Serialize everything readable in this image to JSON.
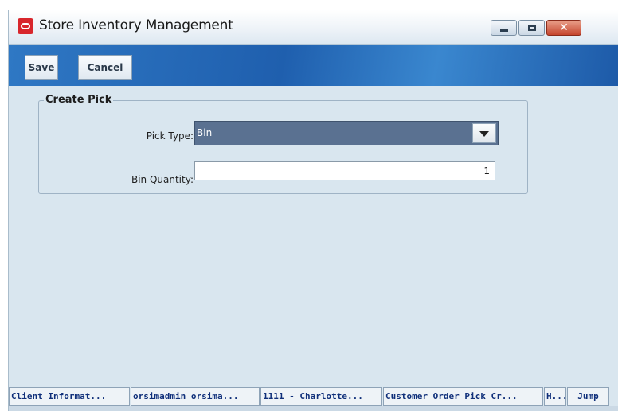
{
  "window": {
    "title": "Store Inventory Management",
    "logo_icon": "oracle-logo-icon",
    "controls": {
      "minimize_icon": "minimize-icon",
      "maximize_icon": "maximize-icon",
      "close_glyph": "✕"
    }
  },
  "toolbar": {
    "save_label": "Save",
    "cancel_label": "Cancel"
  },
  "form": {
    "group_title": "Create Pick",
    "pick_type_label": "Pick Type:",
    "pick_type_value": "Bin",
    "bin_quantity_label": "Bin Quantity:",
    "bin_quantity_value": "1"
  },
  "statusbar": {
    "cells": [
      "Client Informat...",
      "orsimadmin orsima...",
      "1111 - Charlotte...",
      "Customer Order Pick Cr...",
      "H...",
      "Jump"
    ]
  },
  "colors": {
    "toolbar_accent": "#1f5fae",
    "select_bg": "#5a7191",
    "window_bg": "#d9e6ef",
    "status_text": "#0f2f7a"
  }
}
